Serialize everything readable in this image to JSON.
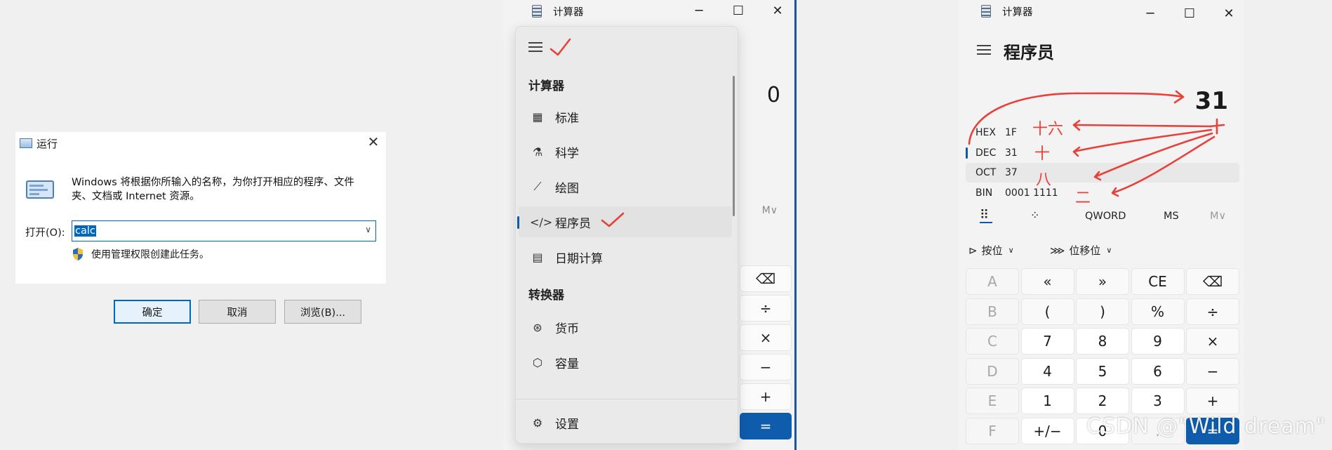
{
  "run_dialog": {
    "title": "运行",
    "close": "✕",
    "description": "Windows 将根据你所输入的名称，为你打开相应的程序、文件夹、文档或 Internet 资源。",
    "open_label": "打开(O):",
    "input_value": "calc",
    "admin_text": "使用管理权限创建此任务。",
    "buttons": {
      "ok": "确定",
      "cancel": "取消",
      "browse": "浏览(B)..."
    }
  },
  "calc_nav": {
    "window_title": "计算器",
    "display": "0",
    "memory": "M∨",
    "sections": {
      "calculator": "计算器",
      "converter": "转换器"
    },
    "items": {
      "standard": "标准",
      "scientific": "科学",
      "graphing": "绘图",
      "programmer": "程序员",
      "date": "日期计算",
      "currency": "货币",
      "volume": "容量",
      "settings": "设置"
    },
    "side_keys": [
      "⌫",
      "÷",
      "×",
      "−",
      "+",
      "="
    ]
  },
  "calc_prog": {
    "window_title": "计算器",
    "mode_title": "程序员",
    "display": "31",
    "radix": [
      {
        "name": "HEX",
        "value": "1F"
      },
      {
        "name": "DEC",
        "value": "31"
      },
      {
        "name": "OCT",
        "value": "37"
      },
      {
        "name": "BIN",
        "value": "0001 1111"
      }
    ],
    "mode_row": {
      "word": "QWORD",
      "ms": "MS",
      "mv": "M∨"
    },
    "bitwise": "按位",
    "bitshift": "位移位",
    "keys": [
      [
        "A",
        "«",
        "»",
        "CE",
        "⌫"
      ],
      [
        "B",
        "(",
        ")",
        "%",
        "÷"
      ],
      [
        "C",
        "7",
        "8",
        "9",
        "×"
      ],
      [
        "D",
        "4",
        "5",
        "6",
        "−"
      ],
      [
        "E",
        "1",
        "2",
        "3",
        "+"
      ],
      [
        "F",
        "+/−",
        "0",
        ".",
        "="
      ]
    ]
  },
  "annotations": {
    "hex_cn": "十六",
    "dec_cn": "十",
    "oct_cn": "八",
    "bin_cn": "二"
  },
  "watermark": "CSDN @\"Wild dream\"",
  "colors": {
    "accent": "#0f5cad",
    "annotation_red": "#e8413a"
  }
}
